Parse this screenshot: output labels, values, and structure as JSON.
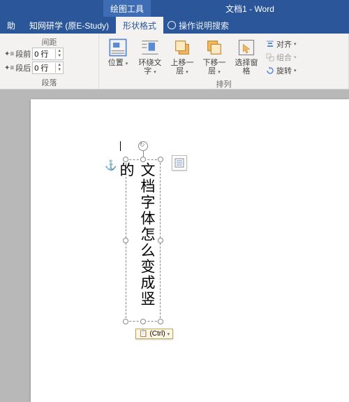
{
  "title": "文档1 - Word",
  "context_tab": "绘图工具",
  "ribbon_tabs": {
    "help": "助",
    "estudy": "知网研学 (原E-Study)",
    "shape_format": "形状格式",
    "tellme": "操作说明搜索"
  },
  "spacing": {
    "header": "间距",
    "before_label": "段前",
    "before_value": "0 行",
    "after_label": "段后",
    "after_value": "0 行",
    "group": "段落"
  },
  "arrange": {
    "position": "位置",
    "wrap": "环绕文\n字",
    "forward": "上移一层",
    "backward": "下移一层",
    "selection": "选择窗格",
    "align": "对齐",
    "group_btn": "组合",
    "rotate": "旋转",
    "group": "排列"
  },
  "textbox_content": "文档字体怎么变成竖的",
  "paste_tag": "(Ctrl)"
}
